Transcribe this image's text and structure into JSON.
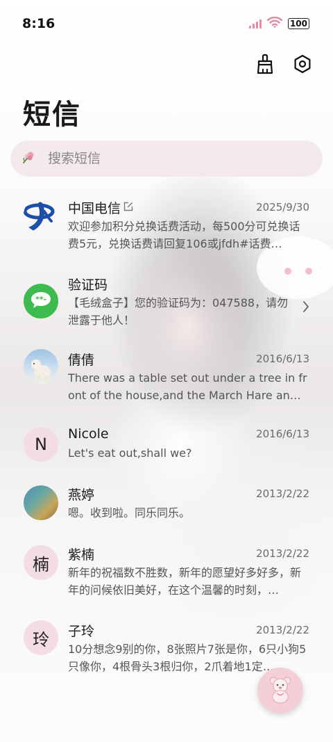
{
  "status": {
    "time": "8:16",
    "battery": "100"
  },
  "header": {
    "title": "短信"
  },
  "search": {
    "placeholder": "搜索短信"
  },
  "conversations": [
    {
      "name": "中国电信",
      "date": "2025/9/30",
      "preview": "欢迎参加积分兑换话费活动，每500分可兑换话费5元，兑换话费请回复106或jfdh#话费…"
    },
    {
      "name": "验证码",
      "date": "",
      "preview": "【毛绒盒子】您的验证码为：047588，请勿泄露于他人！"
    },
    {
      "name": "倩倩",
      "date": "2016/6/13",
      "preview": "There was a table set out under a tree in front of the house,and the March Hare an…"
    },
    {
      "name": "Nicole",
      "date": "2016/6/13",
      "preview": "Let's eat out,shall we?",
      "avatar_letter": "N"
    },
    {
      "name": "燕婷",
      "date": "2013/2/22",
      "preview": "嗯。收到啦。同乐同乐。"
    },
    {
      "name": "紫楠",
      "date": "2013/2/22",
      "preview": "新年的祝福数不胜数，新年的愿望好多好多，新年的问候依旧美好，在这个温馨的时刻，…",
      "avatar_letter": "楠"
    },
    {
      "name": "子玲",
      "date": "2013/2/22",
      "preview": "10分想念9别的你，8张照片7张是你，6只小狗5只像你，4根骨头3根归你，2爪着地1定…",
      "avatar_letter": "玲"
    }
  ],
  "colors": {
    "accent_pink": "#e58aa1",
    "avatar_bg": "#f3dde3",
    "search_bg": "#f2e6e8",
    "telecom_blue": "#1b4fa8",
    "code_green": "#3dbb4f"
  }
}
